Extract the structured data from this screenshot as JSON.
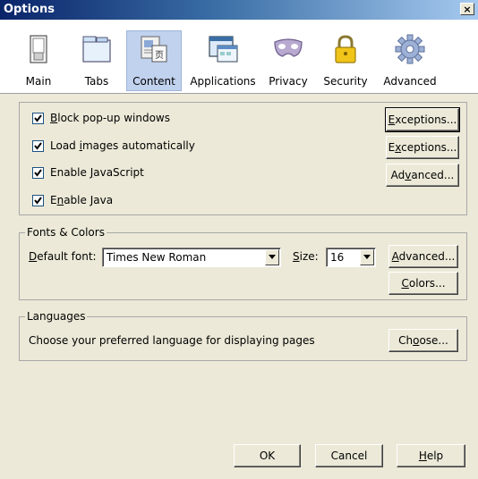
{
  "window": {
    "title": "Options",
    "close_glyph": "×"
  },
  "toolbar": {
    "tabs": [
      {
        "label": "Main",
        "icon": "switch-icon"
      },
      {
        "label": "Tabs",
        "icon": "tabs-icon"
      },
      {
        "label": "Content",
        "icon": "content-icon",
        "selected": true
      },
      {
        "label": "Applications",
        "icon": "applications-icon"
      },
      {
        "label": "Privacy",
        "icon": "mask-icon"
      },
      {
        "label": "Security",
        "icon": "lock-icon"
      },
      {
        "label": "Advanced",
        "icon": "gear-icon"
      }
    ]
  },
  "content": {
    "popup": {
      "label_mnemonic": "B",
      "label_rest": "lock pop-up windows",
      "checked": true,
      "button_mnemonic": "E",
      "button_rest": "xceptions..."
    },
    "images": {
      "label_pre": "Load ",
      "label_mnemonic": "i",
      "label_rest": "mages automatically",
      "checked": true,
      "button_pre": "E",
      "button_mnemonic": "x",
      "button_rest": "ceptions..."
    },
    "javascript": {
      "label_pre": "Enable ",
      "label_mnemonic": "J",
      "label_rest": "avaScript",
      "checked": true,
      "button_pre": "Ad",
      "button_mnemonic": "v",
      "button_rest": "anced..."
    },
    "java": {
      "label_pre": "E",
      "label_mnemonic": "n",
      "label_rest": "able Java",
      "checked": true
    }
  },
  "fonts": {
    "legend": "Fonts & Colors",
    "default_font_mnemonic": "D",
    "default_font_rest": "efault font:",
    "font_value": "Times New Roman",
    "size_mnemonic": "S",
    "size_rest": "ize:",
    "size_value": "16",
    "advanced_mnemonic": "A",
    "advanced_rest": "dvanced...",
    "colors_mnemonic": "C",
    "colors_rest": "olors..."
  },
  "languages": {
    "legend": "Languages",
    "description": "Choose your preferred language for displaying pages",
    "choose_pre": "Ch",
    "choose_mnemonic": "o",
    "choose_rest": "ose..."
  },
  "footer": {
    "ok": "OK",
    "cancel": "Cancel",
    "help_mnemonic": "H",
    "help_rest": "elp"
  }
}
